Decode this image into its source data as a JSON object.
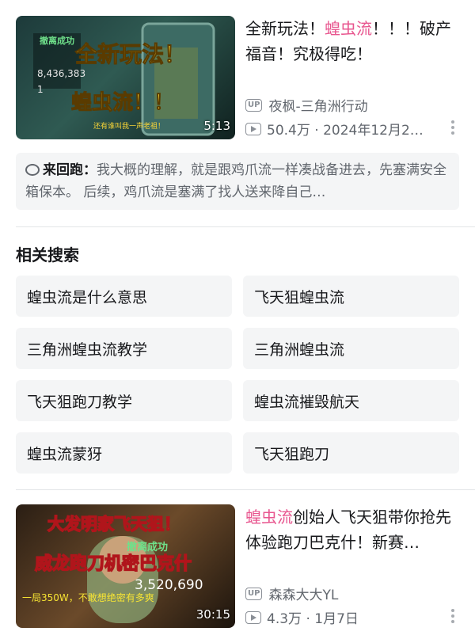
{
  "videos": [
    {
      "title_highlight_before": "全新玩法！",
      "title_highlight": "蝗虫流",
      "title_after": "！！！破产福音！究极得吃！",
      "duration": "5:13",
      "up_badge": "UP",
      "uploader": "夜枫-三角洲行动",
      "meta": "50.4万 · 2024年12月2…",
      "thumb_text": [
        "撤离成功",
        "8,436,383",
        "1",
        "全新玩法！",
        "蝗虫流！！",
        "还有谁叫我一声老祖！"
      ]
    },
    {
      "title_highlight_before": "",
      "title_highlight": "蝗虫流",
      "title_after": "创始人飞天狙带你抢先体验跑刀巴克什！新赛…",
      "duration": "30:15",
      "up_badge": "UP",
      "uploader": "森森大大YL",
      "meta": "4.3万 · 1月7日",
      "thumb_text": [
        "大发明家飞天狙！",
        "撤离成功",
        "威龙跑刀机密巴克什",
        "3,520,690",
        "一局350W，不敢想绝密有多爽"
      ]
    }
  ],
  "comment": {
    "author": "来回跑：",
    "text": "我大概的理解，就是跟鸡爪流一样凑战备进去，先塞满安全箱保本。 后续，鸡爪流是塞满了找人送来降自己…"
  },
  "related": {
    "title": "相关搜索",
    "items": [
      "蝗虫流是什么意思",
      "飞天狙蝗虫流",
      "三角洲蝗虫流教学",
      "三角洲蝗虫流",
      "飞天狙跑刀教学",
      "蝗虫流摧毁航天",
      "蝗虫流蒙犽",
      "飞天狙跑刀"
    ]
  },
  "colors": {
    "highlight": "#e8568f",
    "chip_bg": "#f4f5f6",
    "meta": "#61666d"
  },
  "icons": [
    "comment-icon",
    "play-count-icon",
    "more-icon",
    "up-badge"
  ]
}
